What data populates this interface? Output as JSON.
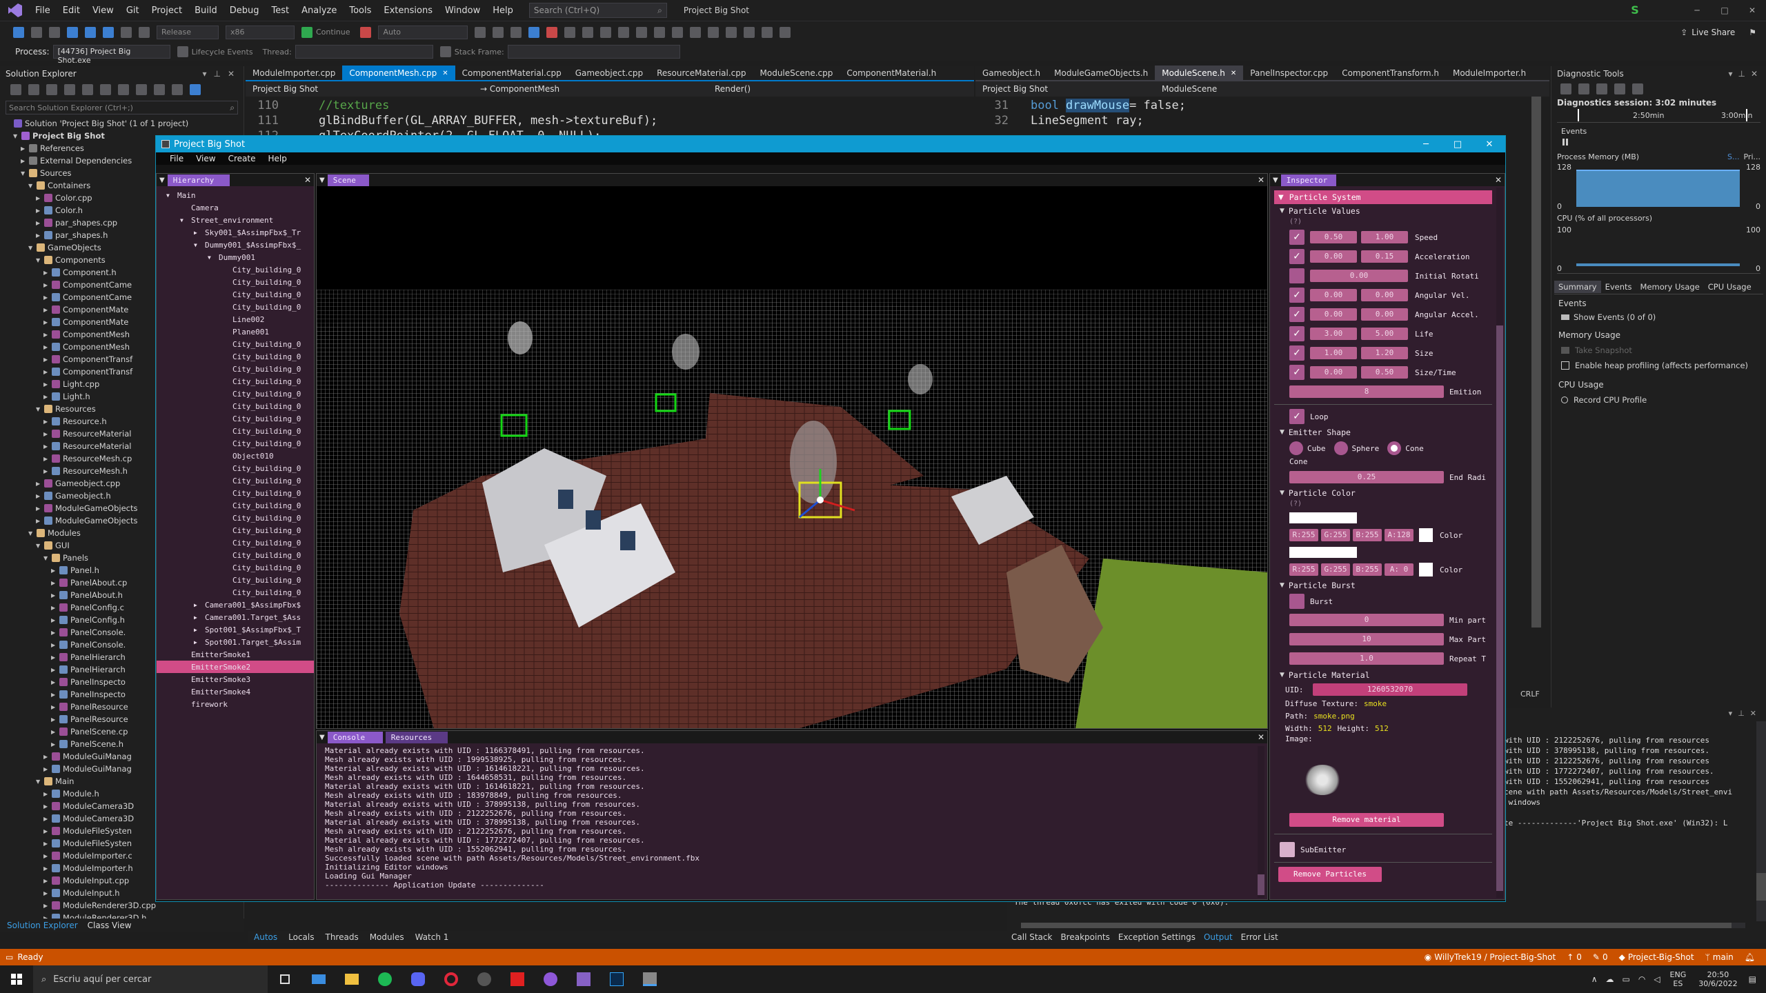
{
  "vs": {
    "menu": [
      "File",
      "Edit",
      "View",
      "Git",
      "Project",
      "Build",
      "Debug",
      "Test",
      "Analyze",
      "Tools",
      "Extensions",
      "Window",
      "Help"
    ],
    "search_placeholder": "Search (Ctrl+Q)",
    "project_title": "Project Big Shot",
    "live_share": "Live Share",
    "user_initial": "S",
    "config": "Release",
    "platform": "x86",
    "continue": "Continue",
    "auto": "Auto",
    "process_label": "Process:",
    "process_value": "[44736] Project Big Shot.exe",
    "lifecycle": "Lifecycle Events",
    "thread_label": "Thread:",
    "stack_frame": "Stack Frame:"
  },
  "solution": {
    "title": "Solution Explorer",
    "search_placeholder": "Search Solution Explorer (Ctrl+;)",
    "rows": [
      {
        "d": 0,
        "t": "Solution 'Project Big Shot' (1 of 1 project)",
        "i": "sln",
        "a": ""
      },
      {
        "d": 1,
        "t": "Project Big Shot",
        "i": "proj",
        "a": "▼"
      },
      {
        "d": 2,
        "t": "References",
        "i": "ref",
        "a": "▶"
      },
      {
        "d": 2,
        "t": "External Dependencies",
        "i": "ref",
        "a": "▶"
      },
      {
        "d": 2,
        "t": "Sources",
        "i": "folder",
        "a": "▼"
      },
      {
        "d": 3,
        "t": "Containers",
        "i": "folder",
        "a": "▼"
      },
      {
        "d": 4,
        "t": "Color.cpp",
        "i": "cpp",
        "a": "▶"
      },
      {
        "d": 4,
        "t": "Color.h",
        "i": "h",
        "a": "▶"
      },
      {
        "d": 4,
        "t": "par_shapes.cpp",
        "i": "cpp",
        "a": "▶"
      },
      {
        "d": 4,
        "t": "par_shapes.h",
        "i": "h",
        "a": "▶"
      },
      {
        "d": 3,
        "t": "GameObjects",
        "i": "folder",
        "a": "▼"
      },
      {
        "d": 4,
        "t": "Components",
        "i": "folder",
        "a": "▼"
      },
      {
        "d": 5,
        "t": "Component.h",
        "i": "h",
        "a": "▶"
      },
      {
        "d": 5,
        "t": "ComponentCame",
        "i": "cpp",
        "a": "▶"
      },
      {
        "d": 5,
        "t": "ComponentCame",
        "i": "h",
        "a": "▶"
      },
      {
        "d": 5,
        "t": "ComponentMate",
        "i": "cpp",
        "a": "▶"
      },
      {
        "d": 5,
        "t": "ComponentMate",
        "i": "h",
        "a": "▶"
      },
      {
        "d": 5,
        "t": "ComponentMesh",
        "i": "cpp",
        "a": "▶"
      },
      {
        "d": 5,
        "t": "ComponentMesh",
        "i": "h",
        "a": "▶"
      },
      {
        "d": 5,
        "t": "ComponentTransf",
        "i": "cpp",
        "a": "▶"
      },
      {
        "d": 5,
        "t": "ComponentTransf",
        "i": "h",
        "a": "▶"
      },
      {
        "d": 5,
        "t": "Light.cpp",
        "i": "cpp",
        "a": "▶"
      },
      {
        "d": 5,
        "t": "Light.h",
        "i": "h",
        "a": "▶"
      },
      {
        "d": 4,
        "t": "Resources",
        "i": "folder",
        "a": "▼"
      },
      {
        "d": 5,
        "t": "Resource.h",
        "i": "h",
        "a": "▶"
      },
      {
        "d": 5,
        "t": "ResourceMaterial",
        "i": "cpp",
        "a": "▶"
      },
      {
        "d": 5,
        "t": "ResourceMaterial",
        "i": "h",
        "a": "▶"
      },
      {
        "d": 5,
        "t": "ResourceMesh.cp",
        "i": "cpp",
        "a": "▶"
      },
      {
        "d": 5,
        "t": "ResourceMesh.h",
        "i": "h",
        "a": "▶"
      },
      {
        "d": 4,
        "t": "Gameobject.cpp",
        "i": "cpp",
        "a": "▶"
      },
      {
        "d": 4,
        "t": "Gameobject.h",
        "i": "h",
        "a": "▶"
      },
      {
        "d": 4,
        "t": "ModuleGameObjects",
        "i": "cpp",
        "a": "▶"
      },
      {
        "d": 4,
        "t": "ModuleGameObjects",
        "i": "h",
        "a": "▶"
      },
      {
        "d": 3,
        "t": "Modules",
        "i": "folder",
        "a": "▼"
      },
      {
        "d": 4,
        "t": "GUI",
        "i": "folder",
        "a": "▼"
      },
      {
        "d": 5,
        "t": "Panels",
        "i": "folder",
        "a": "▼"
      },
      {
        "d": 6,
        "t": "Panel.h",
        "i": "h",
        "a": "▶"
      },
      {
        "d": 6,
        "t": "PanelAbout.cp",
        "i": "cpp",
        "a": "▶"
      },
      {
        "d": 6,
        "t": "PanelAbout.h",
        "i": "h",
        "a": "▶"
      },
      {
        "d": 6,
        "t": "PanelConfig.c",
        "i": "cpp",
        "a": "▶"
      },
      {
        "d": 6,
        "t": "PanelConfig.h",
        "i": "h",
        "a": "▶"
      },
      {
        "d": 6,
        "t": "PanelConsole.",
        "i": "cpp",
        "a": "▶"
      },
      {
        "d": 6,
        "t": "PanelConsole.",
        "i": "h",
        "a": "▶"
      },
      {
        "d": 6,
        "t": "PanelHierarch",
        "i": "cpp",
        "a": "▶"
      },
      {
        "d": 6,
        "t": "PanelHierarch",
        "i": "h",
        "a": "▶"
      },
      {
        "d": 6,
        "t": "PanelInspecto",
        "i": "cpp",
        "a": "▶"
      },
      {
        "d": 6,
        "t": "PanelInspecto",
        "i": "h",
        "a": "▶"
      },
      {
        "d": 6,
        "t": "PanelResource",
        "i": "cpp",
        "a": "▶"
      },
      {
        "d": 6,
        "t": "PanelResource",
        "i": "h",
        "a": "▶"
      },
      {
        "d": 6,
        "t": "PanelScene.cp",
        "i": "cpp",
        "a": "▶"
      },
      {
        "d": 6,
        "t": "PanelScene.h",
        "i": "h",
        "a": "▶"
      },
      {
        "d": 5,
        "t": "ModuleGuiManag",
        "i": "cpp",
        "a": "▶"
      },
      {
        "d": 5,
        "t": "ModuleGuiManag",
        "i": "h",
        "a": "▶"
      },
      {
        "d": 4,
        "t": "Main",
        "i": "folder",
        "a": "▼"
      },
      {
        "d": 5,
        "t": "Module.h",
        "i": "h",
        "a": "▶"
      },
      {
        "d": 5,
        "t": "ModuleCamera3D",
        "i": "cpp",
        "a": "▶"
      },
      {
        "d": 5,
        "t": "ModuleCamera3D",
        "i": "h",
        "a": "▶"
      },
      {
        "d": 5,
        "t": "ModuleFileSysten",
        "i": "cpp",
        "a": "▶"
      },
      {
        "d": 5,
        "t": "ModuleFileSysten",
        "i": "h",
        "a": "▶"
      },
      {
        "d": 5,
        "t": "ModuleImporter.c",
        "i": "cpp",
        "a": "▶"
      },
      {
        "d": 5,
        "t": "ModuleImporter.h",
        "i": "h",
        "a": "▶"
      },
      {
        "d": 5,
        "t": "ModuleInput.cpp",
        "i": "cpp",
        "a": "▶"
      },
      {
        "d": 5,
        "t": "ModuleInput.h",
        "i": "h",
        "a": "▶"
      },
      {
        "d": 5,
        "t": "ModuleRenderer3D.cpp",
        "i": "cpp",
        "a": "▶"
      },
      {
        "d": 5,
        "t": "ModuleRenderer3D.h",
        "i": "h",
        "a": "▶"
      }
    ],
    "bottom_tabs": [
      "Solution Explorer",
      "Class View"
    ]
  },
  "editor_left": {
    "tabs": [
      "ModuleImporter.cpp",
      "ComponentMesh.cpp",
      "ComponentMaterial.cpp",
      "Gameobject.cpp",
      "ResourceMaterial.cpp",
      "ModuleScene.cpp",
      "ComponentMaterial.h"
    ],
    "active": 1,
    "nav": [
      "Project Big Shot",
      "→ ComponentMesh",
      "Render()"
    ],
    "lines": [
      {
        "n": "110",
        "code": "//textures"
      },
      {
        "n": "111",
        "code": "glBindBuffer(GL_ARRAY_BUFFER, mesh->textureBuf);"
      },
      {
        "n": "112",
        "code": "glTexCoordPointer(2, GL_FLOAT, 0, NULL);"
      }
    ]
  },
  "editor_right": {
    "tabs": [
      "Gameobject.h",
      "ModuleGameObjects.h",
      "ModuleScene.h",
      "PanelInspector.cpp",
      "ComponentTransform.h",
      "ModuleImporter.h"
    ],
    "active": 2,
    "nav": [
      "Project Big Shot",
      "ModuleScene"
    ],
    "lines": [
      {
        "n": "31",
        "kw": "bool",
        "var": "drawMouse",
        "rest": " = false;"
      },
      {
        "n": "32",
        "kw": "",
        "var": "",
        "rest": "LineSegment ray;"
      }
    ]
  },
  "diagnostic": {
    "title": "Diagnostic Tools",
    "session": "Diagnostics session: 3:02 minutes",
    "t1": "2:50min",
    "t2": "3:00min",
    "events": "Events",
    "memory": "Process Memory (MB)",
    "mem_legend": [
      "S...",
      "Pri..."
    ],
    "mem_max": "128",
    "mem_min": "0",
    "cpu": "CPU (% of all processors)",
    "cpu_max": "100",
    "cpu_min": "0",
    "tabs": [
      "Summary",
      "Events",
      "Memory Usage",
      "CPU Usage"
    ],
    "events_h": "Events",
    "show_events": "Show Events (0 of 0)",
    "mem_h": "Memory Usage",
    "snapshot": "Take Snapshot",
    "heap": "Enable heap profiling (affects performance)",
    "cpu_h": "CPU Usage",
    "record": "Record CPU Profile"
  },
  "output_lines": [
    "with UID : 2122252676, pulling from resources",
    "with UID : 378995138, pulling from resources.",
    "with UID : 2122252676, pulling from resources",
    "with UID : 1772272407, pulling from resources.",
    "with UID : 1552062941, pulling from resources",
    "cene with path Assets/Resources/Models/Street_envi",
    " windows",
    "",
    "te -------------'Project Big Shot.exe' (Win32): L"
  ],
  "thread_exit": "The thread 0x6fcc has exited with code 0 (0x0).",
  "bottom_left_tabs": [
    "Autos",
    "Locals",
    "Threads",
    "Modules",
    "Watch 1"
  ],
  "bottom_right_tabs": [
    "Call Stack",
    "Breakpoints",
    "Exception Settings",
    "Output",
    "Error List"
  ],
  "crlf": "CRLF",
  "status": {
    "ready": "Ready",
    "repo": "WillyTrek19 / Project-Big-Shot",
    "up": "0",
    "pencil": "0",
    "project": "Project-Big-Shot",
    "branch": "main"
  },
  "taskbar": {
    "search": "Escriu aquí per cercar",
    "lang1": "ENG",
    "lang2": "ES",
    "time": "20:50",
    "date": "30/6/2022"
  },
  "pbs": {
    "title": "Project Big Shot",
    "menu": [
      "File",
      "View",
      "Create",
      "Help"
    ],
    "hierarchy_tab": "Hierarchy",
    "scene_tab": "Scene",
    "inspector_tab": "Inspector",
    "console_tab": "Console",
    "resources_tab": "Resources",
    "hierarchy": [
      {
        "d": 0,
        "t": "Main",
        "a": "▼"
      },
      {
        "d": 1,
        "t": "Camera",
        "a": ""
      },
      {
        "d": 1,
        "t": "Street_environment",
        "a": "▼"
      },
      {
        "d": 2,
        "t": "Sky001_$AssimpFbx$_Tr",
        "a": "▶"
      },
      {
        "d": 2,
        "t": "Dummy001_$AssimpFbx$_",
        "a": "▼"
      },
      {
        "d": 3,
        "t": "Dummy001",
        "a": "▼"
      },
      {
        "d": 4,
        "t": "City_building_0",
        "a": ""
      },
      {
        "d": 4,
        "t": "City_building_0",
        "a": ""
      },
      {
        "d": 4,
        "t": "City_building_0",
        "a": ""
      },
      {
        "d": 4,
        "t": "City_building_0",
        "a": ""
      },
      {
        "d": 4,
        "t": "Line002",
        "a": ""
      },
      {
        "d": 4,
        "t": "Plane001",
        "a": ""
      },
      {
        "d": 4,
        "t": "City_building_0",
        "a": ""
      },
      {
        "d": 4,
        "t": "City_building_0",
        "a": ""
      },
      {
        "d": 4,
        "t": "City_building_0",
        "a": ""
      },
      {
        "d": 4,
        "t": "City_building_0",
        "a": ""
      },
      {
        "d": 4,
        "t": "City_building_0",
        "a": ""
      },
      {
        "d": 4,
        "t": "City_building_0",
        "a": ""
      },
      {
        "d": 4,
        "t": "City_building_0",
        "a": ""
      },
      {
        "d": 4,
        "t": "City_building_0",
        "a": ""
      },
      {
        "d": 4,
        "t": "City_building_0",
        "a": ""
      },
      {
        "d": 4,
        "t": "Object010",
        "a": ""
      },
      {
        "d": 4,
        "t": "City_building_0",
        "a": ""
      },
      {
        "d": 4,
        "t": "City_building_0",
        "a": ""
      },
      {
        "d": 4,
        "t": "City_building_0",
        "a": ""
      },
      {
        "d": 4,
        "t": "City_building_0",
        "a": ""
      },
      {
        "d": 4,
        "t": "City_building_0",
        "a": ""
      },
      {
        "d": 4,
        "t": "City_building_0",
        "a": ""
      },
      {
        "d": 4,
        "t": "City_building_0",
        "a": ""
      },
      {
        "d": 4,
        "t": "City_building_0",
        "a": ""
      },
      {
        "d": 4,
        "t": "City_building_0",
        "a": ""
      },
      {
        "d": 4,
        "t": "City_building_0",
        "a": ""
      },
      {
        "d": 4,
        "t": "City_building_0",
        "a": ""
      },
      {
        "d": 2,
        "t": "Camera001_$AssimpFbx$",
        "a": "▶"
      },
      {
        "d": 2,
        "t": "Camera001.Target_$Ass",
        "a": "▶"
      },
      {
        "d": 2,
        "t": "Spot001_$AssimpFbx$_T",
        "a": "▶"
      },
      {
        "d": 2,
        "t": "Spot001.Target_$Assim",
        "a": "▶"
      },
      {
        "d": 1,
        "t": "EmitterSmoke1",
        "a": ""
      },
      {
        "d": 1,
        "t": "EmitterSmoke2",
        "a": "",
        "sel": true
      },
      {
        "d": 1,
        "t": "EmitterSmoke3",
        "a": ""
      },
      {
        "d": 1,
        "t": "EmitterSmoke4",
        "a": ""
      },
      {
        "d": 1,
        "t": "firework",
        "a": ""
      }
    ],
    "console": [
      "Material already exists with UID : 1166378491, pulling from resources.",
      "Mesh already exists with UID : 1999538925, pulling from resources.",
      "Material already exists with UID : 1614618221, pulling from resources.",
      "Mesh already exists with UID : 1644658531, pulling from resources.",
      "Material already exists with UID : 1614618221, pulling from resources.",
      "Mesh already exists with UID : 183978849, pulling from resources.",
      "Material already exists with UID : 378995138, pulling from resources.",
      "Mesh already exists with UID : 2122252676, pulling from resources.",
      "Material already exists with UID : 378995138, pulling from resources.",
      "Mesh already exists with UID : 2122252676, pulling from resources.",
      "Material already exists with UID : 1772272407, pulling from resources.",
      "Mesh already exists with UID : 1552062941, pulling from resources.",
      "Successfully loaded scene with path Assets/Resources/Models/Street_environment.fbx",
      "Initializing Editor windows",
      "Loading Gui Manager",
      "-------------- Application Update --------------"
    ],
    "inspector": {
      "system": "Particle System",
      "values_h": "Particle Values",
      "help": "(?)",
      "rows": [
        {
          "chk": true,
          "a": "0.50",
          "b": "1.00",
          "l": "Speed"
        },
        {
          "chk": true,
          "a": "0.00",
          "b": "0.15",
          "l": "Acceleration"
        },
        {
          "chk": false,
          "a": "0.00",
          "b": "",
          "l": "Initial Rotati"
        },
        {
          "chk": true,
          "a": "0.00",
          "b": "0.00",
          "l": "Angular Vel."
        },
        {
          "chk": true,
          "a": "0.00",
          "b": "0.00",
          "l": "Angular Accel."
        },
        {
          "chk": true,
          "a": "3.00",
          "b": "5.00",
          "l": "Life"
        },
        {
          "chk": true,
          "a": "1.00",
          "b": "1.20",
          "l": "Size"
        },
        {
          "chk": true,
          "a": "0.00",
          "b": "0.50",
          "l": "Size/Time"
        }
      ],
      "emition_val": "8",
      "emition_l": "Emition",
      "loop": "Loop",
      "shape_h": "Emitter Shape",
      "shapes": [
        "Cube",
        "Sphere",
        "Cone"
      ],
      "shape_current": "Cone",
      "end_radius": "0.25",
      "end_radius_l": "End Radi",
      "color_h": "Particle Color",
      "color_rows": [
        {
          "r": "R:255",
          "g": "G:255",
          "b": "B:255",
          "a": "A:128",
          "l": "Color"
        },
        {
          "r": "R:255",
          "g": "G:255",
          "b": "B:255",
          "a": "A:  0",
          "l": "Color"
        }
      ],
      "burst_h": "Particle Burst",
      "burst": "Burst",
      "burst_rows": [
        {
          "v": "0",
          "l": "Min part"
        },
        {
          "v": "10",
          "l": "Max Part"
        },
        {
          "v": "1.0",
          "l": "Repeat T"
        }
      ],
      "material_h": "Particle Material",
      "uid_l": "UID:",
      "uid": "1260532070",
      "diffuse_l": "Diffuse Texture:",
      "diffuse": "smoke",
      "path_l": "Path:",
      "path": "smoke.png",
      "width_l": "Width:",
      "width": "512",
      "height_l": "Height:",
      "height": "512",
      "image_l": "Image:",
      "remove_material": "Remove material",
      "subemitter": "SubEmitter",
      "remove_particles": "Remove Particles"
    }
  },
  "colors": {
    "vs_accent": "#007acc",
    "status": "#ca5100",
    "imgui_bg": "#301d2d",
    "imgui_tab": "#8b59c9",
    "imgui_field": "#b7608f",
    "imgui_button": "#d14c87"
  }
}
